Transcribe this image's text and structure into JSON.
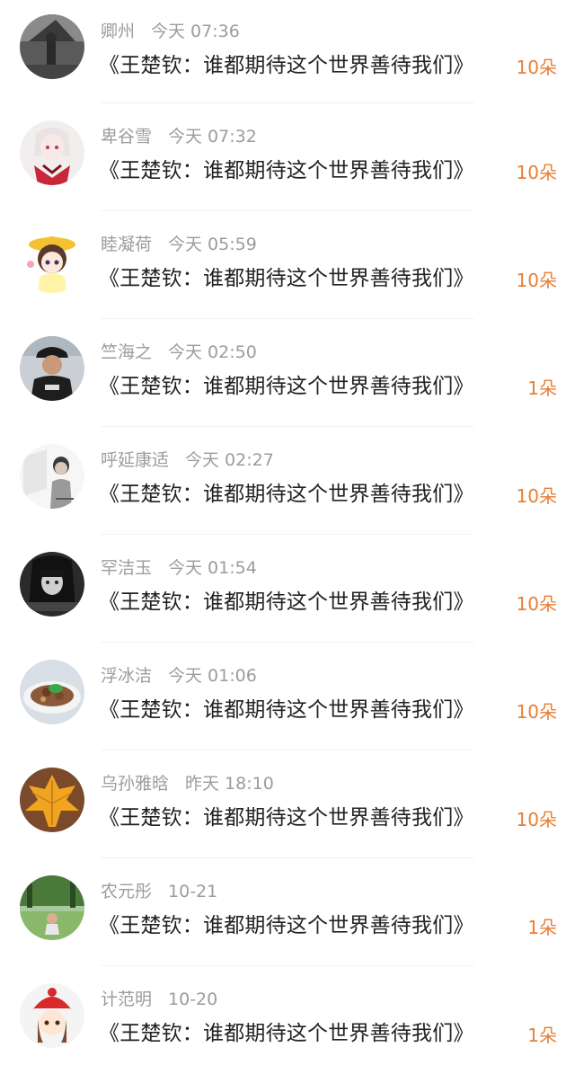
{
  "items": [
    {
      "name": "卿州",
      "time": "今天 07:36",
      "title": "《王楚钦：谁都期待这个世界善待我们》",
      "count": "10朵",
      "avatar": "dark-street-photo"
    },
    {
      "name": "卑谷雪",
      "time": "今天 07:32",
      "title": "《王楚钦：谁都期待这个世界善待我们》",
      "count": "10朵",
      "avatar": "anime-girl-red"
    },
    {
      "name": "睦凝荷",
      "time": "今天 05:59",
      "title": "《王楚钦：谁都期待这个世界善待我们》",
      "count": "10朵",
      "avatar": "anime-girl-hat"
    },
    {
      "name": "竺海之",
      "time": "今天 02:50",
      "title": "《王楚钦：谁都期待这个世界善待我们》",
      "count": "1朵",
      "avatar": "man-black-cap"
    },
    {
      "name": "呼延康适",
      "time": "今天 02:27",
      "title": "《王楚钦：谁都期待这个世界善待我们》",
      "count": "10朵",
      "avatar": "sketch-boy"
    },
    {
      "name": "罕洁玉",
      "time": "今天 01:54",
      "title": "《王楚钦：谁都期待这个世界善待我们》",
      "count": "10朵",
      "avatar": "bw-girl"
    },
    {
      "name": "浮冰洁",
      "time": "今天 01:06",
      "title": "《王楚钦：谁都期待这个世界善待我们》",
      "count": "10朵",
      "avatar": "food-plate"
    },
    {
      "name": "乌孙雅晗",
      "time": "昨天 18:10",
      "title": "《王楚钦：谁都期待这个世界善待我们》",
      "count": "10朵",
      "avatar": "maple-leaf"
    },
    {
      "name": "农元彤",
      "time": "10-21",
      "title": "《王楚钦：谁都期待这个世界善待我们》",
      "count": "1朵",
      "avatar": "park-child"
    },
    {
      "name": "计范明",
      "time": "10-20",
      "title": "《王楚钦：谁都期待这个世界善待我们》",
      "count": "1朵",
      "avatar": "cartoon-red-hat"
    }
  ],
  "colors": {
    "accent": "#e87e34",
    "meta": "#9c9c9c",
    "title": "#222222"
  }
}
